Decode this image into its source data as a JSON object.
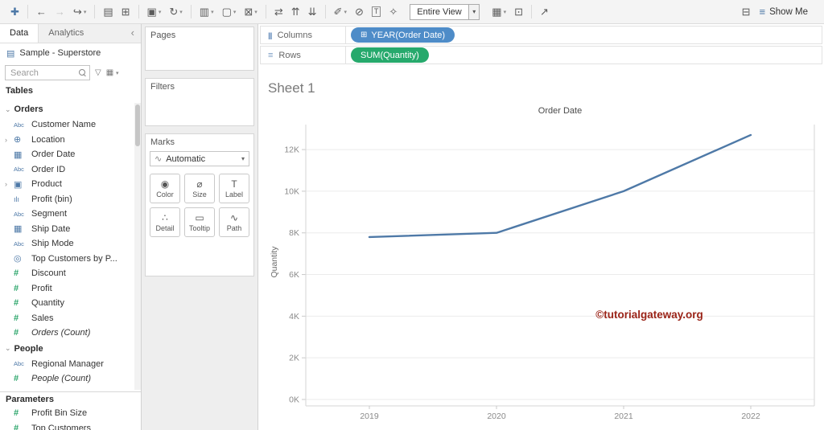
{
  "colors": {
    "pill_blue": "#4e8cc8",
    "pill_green": "#26a96c",
    "dimension_icon": "#4e79a7",
    "measure_icon": "#2aa56a",
    "watermark": "#9b2418"
  },
  "toolbar": {
    "fit_mode": "Entire View",
    "show_me_label": "Show Me",
    "items": [
      {
        "name": "tableau-logo",
        "glyph": "✚",
        "color": "#4e79a7"
      },
      {
        "sep": true
      },
      {
        "name": "undo-icon",
        "glyph": "←"
      },
      {
        "name": "redo-icon",
        "glyph": "→",
        "disabled": true
      },
      {
        "name": "replay-icon",
        "glyph": "↪",
        "caret": true
      },
      {
        "sep": true
      },
      {
        "name": "save-icon",
        "glyph": "▤"
      },
      {
        "name": "new-datasource-icon",
        "glyph": "⊞"
      },
      {
        "sep": true
      },
      {
        "name": "new-worksheet-icon",
        "glyph": "▣",
        "caret": true
      },
      {
        "name": "refresh-icon",
        "glyph": "↻",
        "caret": true
      },
      {
        "sep": true
      },
      {
        "name": "new-dashboard-icon",
        "glyph": "▥",
        "caret": true
      },
      {
        "name": "duplicate-sheet-icon",
        "glyph": "▢",
        "caret": true
      },
      {
        "name": "clear-sheet-icon",
        "glyph": "⊠",
        "caret": true
      },
      {
        "sep": true
      },
      {
        "name": "swap-axes-icon",
        "glyph": "⇄"
      },
      {
        "name": "sort-ascending-icon",
        "glyph": "⇈"
      },
      {
        "name": "sort-descending-icon",
        "glyph": "⇊"
      },
      {
        "sep": true
      },
      {
        "name": "highlight-icon",
        "glyph": "✐",
        "caret": true
      },
      {
        "name": "attach-icon",
        "glyph": "⊘"
      },
      {
        "name": "text-label-icon",
        "glyph": "T",
        "boxed": true
      },
      {
        "name": "fix-axes-icon",
        "glyph": "✧"
      },
      {
        "type": "fit"
      },
      {
        "name": "show-mark-labels-icon",
        "glyph": "▦",
        "caret": true
      },
      {
        "name": "presentation-mode-icon",
        "glyph": "⊡"
      },
      {
        "sep": true
      },
      {
        "name": "share-icon",
        "glyph": "↗"
      },
      {
        "type": "spacer"
      },
      {
        "name": "show-hide-cards-icon",
        "glyph": "⊟"
      },
      {
        "type": "showme"
      }
    ]
  },
  "sidebar": {
    "tabs": [
      {
        "label": "Data",
        "active": true
      },
      {
        "label": "Analytics",
        "active": false
      }
    ],
    "collapse_glyph": "‹",
    "datasource": {
      "name": "Sample - Superstore"
    },
    "search": {
      "placeholder": "Search"
    },
    "tables_label": "Tables",
    "sections": [
      {
        "name": "Orders",
        "fields": [
          {
            "label": "Customer Name",
            "icon": "abc"
          },
          {
            "label": "Location",
            "icon": "globe",
            "expandable": true
          },
          {
            "label": "Order Date",
            "icon": "calendar"
          },
          {
            "label": "Order ID",
            "icon": "abc"
          },
          {
            "label": "Product",
            "icon": "hierarchy",
            "expandable": true
          },
          {
            "label": "Profit (bin)",
            "icon": "bin"
          },
          {
            "label": "Segment",
            "icon": "abc"
          },
          {
            "label": "Ship Date",
            "icon": "calendar"
          },
          {
            "label": "Ship Mode",
            "icon": "abc"
          },
          {
            "label": "Top Customers by P...",
            "icon": "set"
          },
          {
            "label": "Discount",
            "icon": "hash"
          },
          {
            "label": "Profit",
            "icon": "hash"
          },
          {
            "label": "Quantity",
            "icon": "hash"
          },
          {
            "label": "Sales",
            "icon": "hash"
          },
          {
            "label": "Orders (Count)",
            "icon": "hash",
            "italic": true
          }
        ]
      },
      {
        "name": "People",
        "fields": [
          {
            "label": "Regional Manager",
            "icon": "abc"
          },
          {
            "label": "People (Count)",
            "icon": "hash",
            "italic": true
          }
        ]
      }
    ],
    "parameters": {
      "label": "Parameters",
      "fields": [
        {
          "label": "Profit Bin Size",
          "icon": "hash"
        },
        {
          "label": "Top Customers",
          "icon": "hash"
        }
      ]
    }
  },
  "cards": {
    "pages": {
      "label": "Pages"
    },
    "filters": {
      "label": "Filters"
    },
    "marks": {
      "label": "Marks",
      "mark_type": "Automatic",
      "buttons": [
        {
          "label": "Color",
          "icon": "color"
        },
        {
          "label": "Size",
          "icon": "size"
        },
        {
          "label": "Label",
          "icon": "label"
        },
        {
          "label": "Detail",
          "icon": "detail"
        },
        {
          "label": "Tooltip",
          "icon": "tooltip"
        },
        {
          "label": "Path",
          "icon": "path"
        }
      ]
    }
  },
  "shelves": {
    "columns": {
      "label": "Columns",
      "pill": "YEAR(Order Date)"
    },
    "rows": {
      "label": "Rows",
      "pill": "SUM(Quantity)"
    }
  },
  "sheet": {
    "title": "Sheet 1",
    "watermark": "©tutorialgateway.org"
  },
  "chart_data": {
    "type": "line",
    "title": "Order Date",
    "x": [
      "2019",
      "2020",
      "2021",
      "2022"
    ],
    "series": [
      {
        "name": "SUM(Quantity)",
        "values": [
          7800,
          8000,
          10000,
          12700
        ]
      }
    ],
    "xlabel": "Order Date",
    "ylabel": "Quantity",
    "ylim": [
      0,
      13200
    ],
    "ytick_values": [
      0,
      2000,
      4000,
      6000,
      8000,
      10000,
      12000
    ],
    "ytick_labels": [
      "0K",
      "2K",
      "4K",
      "6K",
      "8K",
      "10K",
      "12K"
    ],
    "grid": true,
    "legend": "none",
    "line_color": "#4e79a7"
  }
}
